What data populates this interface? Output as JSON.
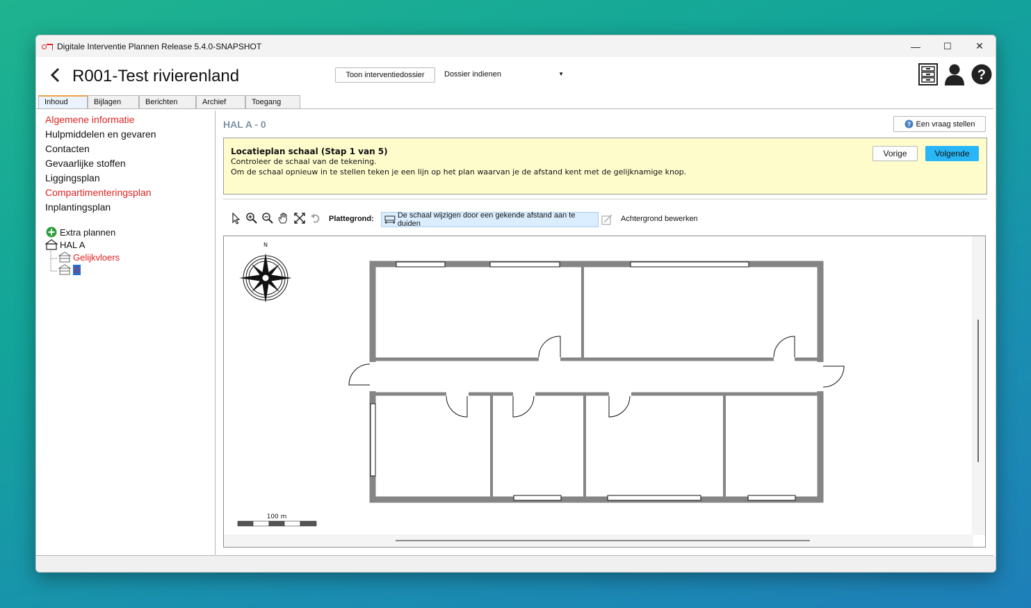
{
  "window": {
    "title": "Digitale Interventie Plannen Release 5.4.0-SNAPSHOT",
    "minimize": "—",
    "maximize": "☐",
    "close": "✕"
  },
  "header": {
    "dossier_title": "R001-Test rivierenland",
    "show_dossier_button": "Toon interventiedossier",
    "submit_select_value": "Dossier indienen",
    "icons": [
      "cabinet-icon",
      "user-icon",
      "help-icon"
    ]
  },
  "tabs": [
    "Inhoud",
    "Bijlagen",
    "Berichten",
    "Archief",
    "Toegang"
  ],
  "sidebar": {
    "items": [
      {
        "label": "Algemene informatie",
        "red": true
      },
      {
        "label": "Hulpmiddelen en gevaren",
        "red": false
      },
      {
        "label": "Contacten",
        "red": false
      },
      {
        "label": "Gevaarlijke stoffen",
        "red": false
      },
      {
        "label": "Liggingsplan",
        "red": false
      },
      {
        "label": "Compartimenteringsplan",
        "red": true
      },
      {
        "label": "Inplantingsplan",
        "red": false
      }
    ],
    "tree": {
      "extra_label": "Extra plannen",
      "building": "HAL A",
      "floor_1": "Gelijkvloers",
      "floor_2": "0"
    }
  },
  "main": {
    "title": "HAL A - 0",
    "ask_question_button": "Een vraag stellen",
    "notice": {
      "title": "Locatieplan schaal (Stap 1 van 5)",
      "line1": "Controleer de schaal van de tekening.",
      "line2": "Om de schaal opnieuw in te stellen teken je een lijn op het plan waarvan je de afstand kent met de gelijknamige knop.",
      "prev_button": "Vorige",
      "next_button": "Volgende"
    },
    "toolbar": {
      "tool_icons": [
        "pointer-icon",
        "zoom-in-icon",
        "zoom-out-icon",
        "pan-hand-icon",
        "fit-extent-icon",
        "undo-icon"
      ],
      "plattegrond_label": "Plattegrond:",
      "scale_button": "De schaal wijzigen door een gekende afstand aan te duiden",
      "edit_background": "Achtergrond bewerken"
    },
    "map": {
      "north_label": "N",
      "scale_label": "100 m"
    }
  },
  "colors": {
    "accent": "#29b6f6",
    "warning_bg": "#fffccc",
    "red_text": "#e02020",
    "wall": "#858585"
  }
}
